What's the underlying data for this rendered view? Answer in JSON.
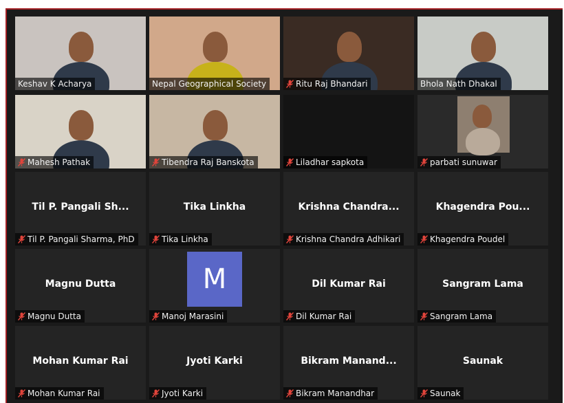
{
  "participants": [
    {
      "display_name": "Keshav K Acharya",
      "muted": false,
      "active": true,
      "video": true,
      "bg": "#c9c3bf"
    },
    {
      "display_name": "Nepal Geographical Society",
      "muted": false,
      "active": false,
      "video": true,
      "bg": "#d1a88a"
    },
    {
      "display_name": "Ritu Raj Bhandari",
      "muted": true,
      "active": false,
      "video": true,
      "bg": "#3a2b23"
    },
    {
      "display_name": "Bhola Nath Dhakal",
      "muted": false,
      "active": false,
      "video": true,
      "bg": "#c8cbc6"
    },
    {
      "display_name": "Mahesh Pathak",
      "muted": true,
      "active": false,
      "video": true,
      "bg": "#d9d3c7"
    },
    {
      "display_name": "Tibendra Raj Banskota",
      "muted": true,
      "active": false,
      "video": true,
      "bg": "#c7b7a3"
    },
    {
      "display_name": "Liladhar sapkota",
      "muted": true,
      "active": false,
      "video": true,
      "bg": "#141414"
    },
    {
      "display_name": "parbati sunuwar",
      "muted": true,
      "active": false,
      "video": true,
      "bg": "#2a2a2a"
    },
    {
      "display_name": "Til P. Pangali Sharma, PhD",
      "center_label": "Til P. Pangali Sh...",
      "muted": true
    },
    {
      "display_name": "Tika Linkha",
      "center_label": "Tika Linkha",
      "muted": true
    },
    {
      "display_name": "Krishna Chandra Adhikari",
      "center_label": "Krishna  Chandra...",
      "muted": true
    },
    {
      "display_name": "Khagendra Poudel",
      "center_label": "Khagendra  Pou...",
      "muted": true
    },
    {
      "display_name": "Magnu Dutta",
      "center_label": "Magnu Dutta",
      "muted": true
    },
    {
      "display_name": "Manoj Marasini",
      "avatar_letter": "M",
      "muted": true
    },
    {
      "display_name": "Dil Kumar Rai",
      "center_label": "Dil Kumar Rai",
      "muted": true
    },
    {
      "display_name": "Sangram Lama",
      "center_label": "Sangram Lama",
      "muted": true
    },
    {
      "display_name": "Mohan Kumar Rai",
      "center_label": "Mohan Kumar Rai",
      "muted": true
    },
    {
      "display_name": "Jyoti Karki",
      "center_label": "Jyoti Karki",
      "muted": true
    },
    {
      "display_name": "Bikram Manandhar",
      "center_label": "Bikram  Manand...",
      "muted": true
    },
    {
      "display_name": "Saunak",
      "center_label": "Saunak",
      "muted": true
    }
  ],
  "colors": {
    "active_border": "#d6dc6b",
    "mute_icon": "#e0443b",
    "avatar_bg": "#5a67c7"
  },
  "icons": {
    "muted": "mic-off-icon"
  }
}
